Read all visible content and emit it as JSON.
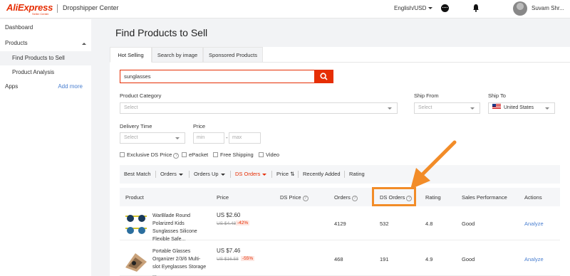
{
  "header": {
    "logo": "AliExpress",
    "logo_sub": "Seller Center",
    "title": "Dropshipper Center",
    "language": "English/USD",
    "username": "Suvam Shr..."
  },
  "sidebar": {
    "items": [
      {
        "label": "Dashboard"
      },
      {
        "label": "Products"
      },
      {
        "label": "Find Products to Sell"
      },
      {
        "label": "Product Analysis"
      },
      {
        "label": "Apps"
      }
    ],
    "add_more": "Add more"
  },
  "page": {
    "title": "Find Products to Sell"
  },
  "tabs": [
    "Hot Selling",
    "Search by image",
    "Sponsored Products"
  ],
  "search": {
    "value": "sunglasses"
  },
  "filters": {
    "category_label": "Product Category",
    "category_placeholder": "Select",
    "ship_from_label": "Ship From",
    "ship_from_placeholder": "Select",
    "ship_to_label": "Ship To",
    "ship_to_value": "United States",
    "delivery_label": "Delivery Time",
    "delivery_placeholder": "Select",
    "price_label": "Price",
    "price_min_placeholder": "min",
    "price_max_placeholder": "max",
    "price_separator": "-",
    "checkboxes": [
      "Exclusive DS Price",
      "ePacket",
      "Free Shipping",
      "Video"
    ]
  },
  "sort": {
    "items": [
      "Best Match",
      "Orders",
      "Orders Up",
      "DS Orders",
      "Price",
      "Recently Added",
      "Rating"
    ],
    "price_icon": "⇅"
  },
  "table": {
    "headers": [
      "Product",
      "Price",
      "DS Price",
      "Orders",
      "DS Orders",
      "Rating",
      "Sales Performance",
      "Actions"
    ],
    "rows": [
      {
        "title": "WarBlade Round Polarized Kids Sunglasses Silicone Flexible Safe...",
        "price": "US $2.60",
        "original_price": "US $4.48",
        "discount": "-42%",
        "orders": "4129",
        "ds_orders": "532",
        "rating": "4.8",
        "performance": "Good",
        "action": "Analyze"
      },
      {
        "title": "Portable Glasses Organizer 2/3/6 Multi-slot Eyeglasses Storage ...",
        "price": "US $7.46",
        "original_price": "US $16.58",
        "discount": "-55%",
        "orders": "468",
        "ds_orders": "191",
        "rating": "4.9",
        "performance": "Good",
        "action": "Analyze"
      }
    ]
  },
  "icons": {
    "search": "search-icon",
    "message": "message-icon",
    "bell": "bell-icon",
    "help": "?"
  },
  "colors": {
    "brand": "#e62e04",
    "link": "#4a7fd0",
    "annotation": "#f28c28"
  }
}
